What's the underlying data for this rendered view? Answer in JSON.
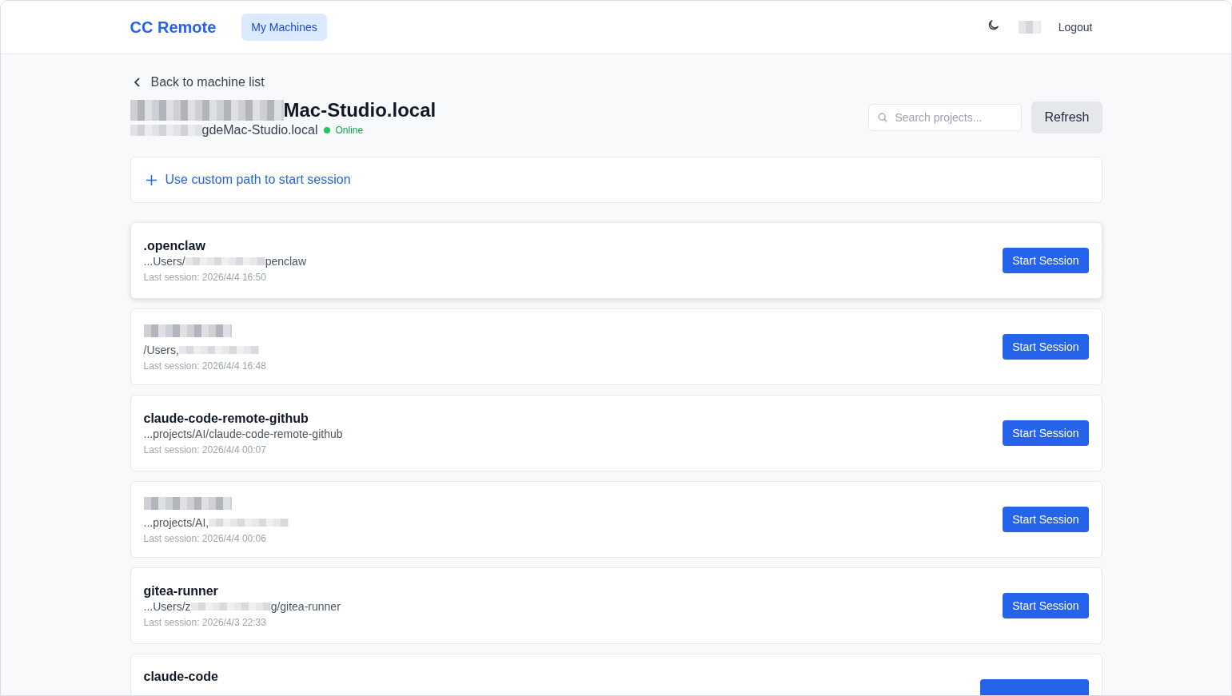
{
  "header": {
    "brand": "CC Remote",
    "nav": [
      {
        "label": "My Machines",
        "selected": true
      }
    ],
    "user_redacted": true,
    "logout": "Logout"
  },
  "back_link": "Back to machine list",
  "machine": {
    "name_visible": "Mac-Studio.local",
    "name_redacted": true,
    "host_visible": "gdeMac-Studio.local",
    "host_redacted": true,
    "status": "Online",
    "online": true
  },
  "search": {
    "placeholder": "Search projects..."
  },
  "refresh_button": "Refresh",
  "custom_path": "Use custom path to start session",
  "projects": [
    {
      "name": ".openclaw",
      "path_before": "...Users/",
      "path_redacted": true,
      "path_after": "penclaw",
      "last_session": "Last session: 2026/4/4 16:50",
      "hovered": true,
      "button": "Start Session"
    },
    {
      "name_redacted": true,
      "path_before": "/Users,",
      "path_redacted": true,
      "last_session": "Last session: 2026/4/4 16:48",
      "hovered": false,
      "button": "Start Session"
    },
    {
      "name": "claude-code-remote-github",
      "path_before": "...projects/AI/claude-code-remote-github",
      "path_redacted": false,
      "last_session": "Last session: 2026/4/4 00:07",
      "hovered": false,
      "button": "Start Session"
    },
    {
      "name_redacted": true,
      "path_before": "...projects/AI,",
      "path_redacted": true,
      "last_session": "Last session: 2026/4/4 00:06",
      "hovered": false,
      "button": "Start Session"
    },
    {
      "name": "gitea-runner",
      "path_before": "...Users/z",
      "path_redacted": true,
      "path_after": "g/gitea-runner",
      "last_session": "Last session: 2026/4/3 22:33",
      "hovered": false,
      "button": "Start Session"
    },
    {
      "name": "claude-code",
      "hovered": false
    }
  ]
}
